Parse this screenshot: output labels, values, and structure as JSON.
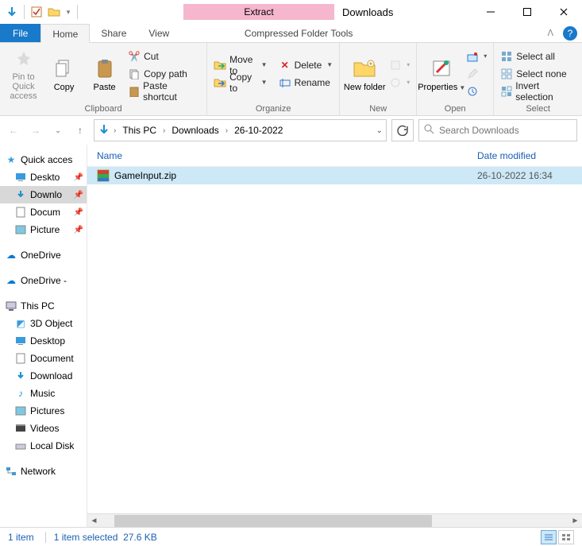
{
  "window": {
    "title": "Downloads",
    "context_tab": "Extract",
    "context_group": "Compressed Folder Tools"
  },
  "tabs": {
    "file": "File",
    "home": "Home",
    "share": "Share",
    "view": "View"
  },
  "ribbon": {
    "clipboard": {
      "label": "Clipboard",
      "pin": "Pin to Quick access",
      "copy": "Copy",
      "paste": "Paste",
      "cut": "Cut",
      "copy_path": "Copy path",
      "paste_shortcut": "Paste shortcut"
    },
    "organize": {
      "label": "Organize",
      "move": "Move to",
      "copy": "Copy to",
      "delete": "Delete",
      "rename": "Rename"
    },
    "new_group": {
      "label": "New",
      "new_folder": "New folder"
    },
    "open": {
      "label": "Open",
      "properties": "Properties"
    },
    "select": {
      "label": "Select",
      "all": "Select all",
      "none": "Select none",
      "invert": "Invert selection"
    }
  },
  "breadcrumb": {
    "root": "This PC",
    "p1": "Downloads",
    "p2": "26-10-2022"
  },
  "search": {
    "placeholder": "Search Downloads"
  },
  "tree": {
    "quick": "Quick acces",
    "desktop": "Deskto",
    "downloads": "Downlo",
    "documents": "Docum",
    "pictures": "Picture",
    "onedrive": "OneDrive",
    "onedrive2": "OneDrive -",
    "thispc": "This PC",
    "objects3d": "3D Object",
    "desktop2": "Desktop",
    "documents2": "Document",
    "downloads2": "Download",
    "music": "Music",
    "pictures2": "Pictures",
    "videos": "Videos",
    "localdisk": "Local Disk",
    "network": "Network"
  },
  "columns": {
    "name": "Name",
    "date": "Date modified"
  },
  "files": [
    {
      "name": "GameInput.zip",
      "date": "26-10-2022 16:34"
    }
  ],
  "status": {
    "count": "1 item",
    "selected": "1 item selected",
    "size": "27.6 KB"
  }
}
